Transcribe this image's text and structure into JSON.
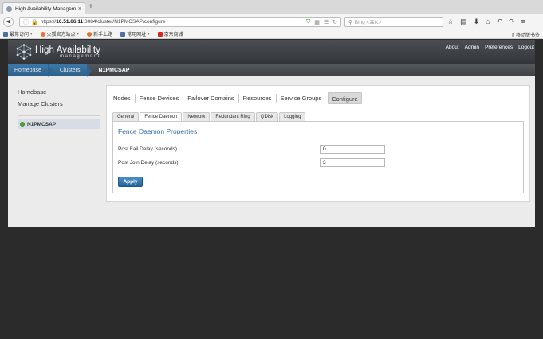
{
  "browser": {
    "tab_title": "High Availability Managem...",
    "tab_close": "×",
    "new_tab": "+",
    "url_prefix": "https://",
    "url_host": "10.51.66.11",
    "url_path": ":8084/cluster/N1PMCSAP/configure",
    "search_placeholder": "Bing <⌘K>",
    "bookmarks": [
      {
        "label": "最常访问",
        "color": "#4a6fa5",
        "dropdown": true
      },
      {
        "label": "火狐官方站点",
        "color": "#e8733a",
        "dropdown": true
      },
      {
        "label": "新手上路",
        "color": "#e0702f",
        "dropdown": false
      },
      {
        "label": "常用网址",
        "color": "#4a6fa5",
        "dropdown": true
      },
      {
        "label": "京东商城",
        "color": "#d9281e",
        "dropdown": false
      }
    ],
    "mobile_bookmarks": "移动版书签"
  },
  "app": {
    "title": "High Availability",
    "subtitle": "management",
    "top_links": [
      "About",
      "Admin",
      "Preferences",
      "Logout"
    ],
    "breadcrumbs": {
      "home": "Homebase",
      "clusters": "Clusters",
      "current": "N1PMCSAP"
    },
    "sidebar": {
      "homebase": "Homebase",
      "manage_clusters": "Manage Clusters",
      "cluster_name": "N1PMCSAP",
      "status_color": "#4caa2c"
    },
    "main_tabs": [
      "Nodes",
      "Fence Devices",
      "Failover Domains",
      "Resources",
      "Service Groups",
      "Configure"
    ],
    "active_main_tab": "Configure",
    "sub_tabs": [
      "General",
      "Fence Daemon",
      "Network",
      "Redundant Ring",
      "QDisk",
      "Logging"
    ],
    "active_sub_tab": "Fence Daemon",
    "panel": {
      "title": "Fence Daemon Properties",
      "post_fail_label": "Post Fail Delay (seconds)",
      "post_fail_value": "0",
      "post_join_label": "Post Join Delay (seconds)",
      "post_join_value": "3",
      "apply_label": "Apply"
    }
  }
}
